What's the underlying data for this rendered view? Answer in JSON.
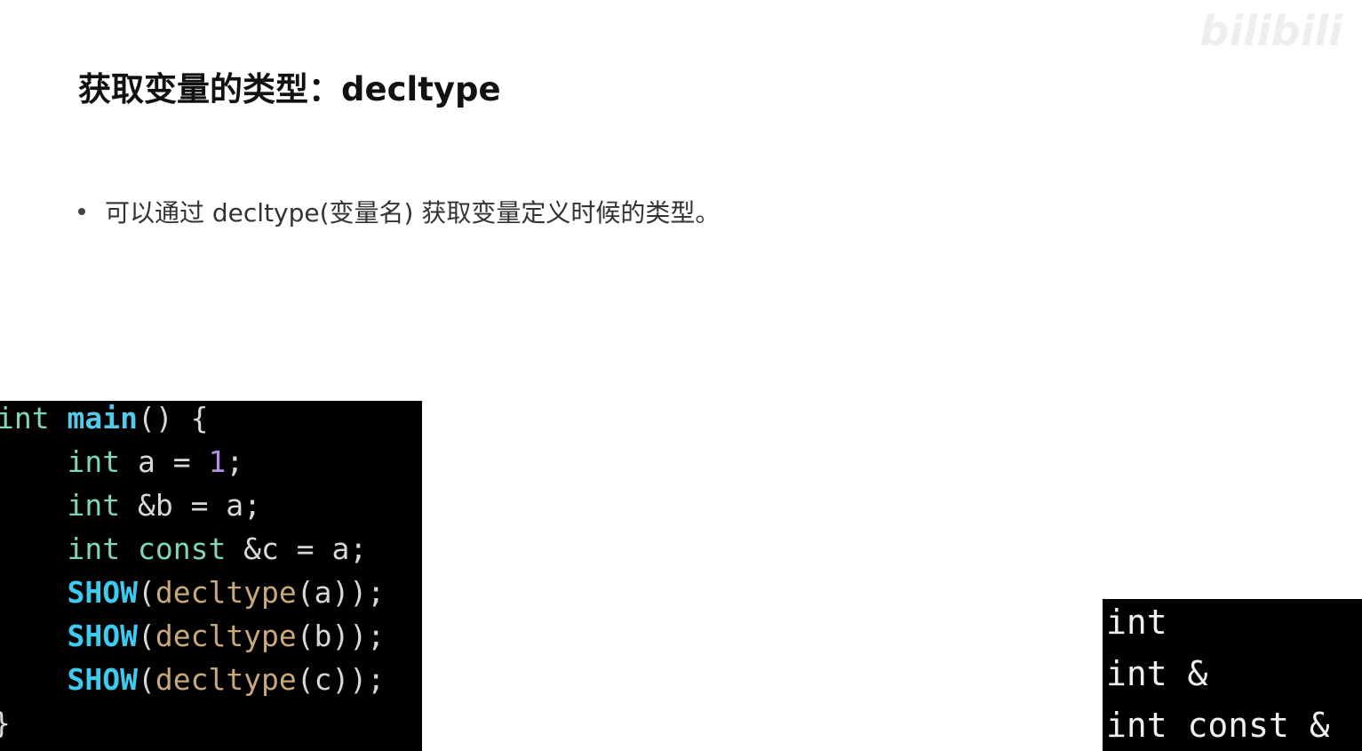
{
  "slide": {
    "title": "获取变量的类型：decltype",
    "bullet": "可以通过 decltype(变量名) 获取变量定义时候的类型。",
    "watermark": "bilibili"
  },
  "code": {
    "lines": [
      [
        {
          "t": "int",
          "k": "type"
        },
        {
          "t": " ",
          "k": "plain"
        },
        {
          "t": "main",
          "k": "fn"
        },
        {
          "t": "() {",
          "k": "plain"
        }
      ],
      [
        {
          "t": "    ",
          "k": "plain"
        },
        {
          "t": "int",
          "k": "type"
        },
        {
          "t": " a = ",
          "k": "plain"
        },
        {
          "t": "1",
          "k": "num"
        },
        {
          "t": ";",
          "k": "plain"
        }
      ],
      [
        {
          "t": "    ",
          "k": "plain"
        },
        {
          "t": "int",
          "k": "type"
        },
        {
          "t": " &b = a;",
          "k": "plain"
        }
      ],
      [
        {
          "t": "    ",
          "k": "plain"
        },
        {
          "t": "int",
          "k": "type"
        },
        {
          "t": " ",
          "k": "plain"
        },
        {
          "t": "const",
          "k": "type"
        },
        {
          "t": " &c = a;",
          "k": "plain"
        }
      ],
      [
        {
          "t": "    ",
          "k": "plain"
        },
        {
          "t": "SHOW",
          "k": "macro"
        },
        {
          "t": "(",
          "k": "plain"
        },
        {
          "t": "decltype",
          "k": "call"
        },
        {
          "t": "(a));",
          "k": "plain"
        }
      ],
      [
        {
          "t": "    ",
          "k": "plain"
        },
        {
          "t": "SHOW",
          "k": "macro"
        },
        {
          "t": "(",
          "k": "plain"
        },
        {
          "t": "decltype",
          "k": "call"
        },
        {
          "t": "(b));",
          "k": "plain"
        }
      ],
      [
        {
          "t": "    ",
          "k": "plain"
        },
        {
          "t": "SHOW",
          "k": "macro"
        },
        {
          "t": "(",
          "k": "plain"
        },
        {
          "t": "decltype",
          "k": "call"
        },
        {
          "t": "(c));",
          "k": "plain"
        }
      ],
      [
        {
          "t": "}",
          "k": "plain"
        }
      ]
    ]
  },
  "output": {
    "lines": [
      "int",
      "int &",
      "int const &"
    ]
  }
}
